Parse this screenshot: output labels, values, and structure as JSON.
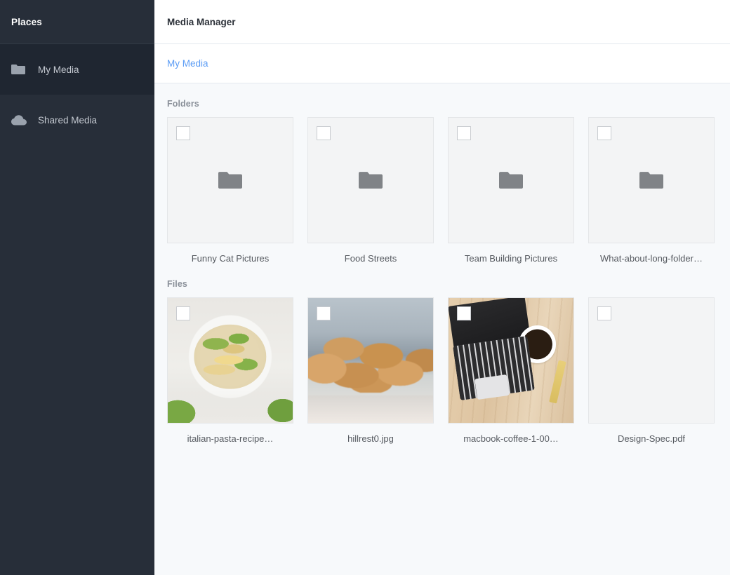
{
  "sidebar": {
    "title": "Places",
    "items": [
      {
        "label": "My Media",
        "icon": "folder-icon",
        "active": true
      },
      {
        "label": "Shared Media",
        "icon": "cloud-icon",
        "active": false
      }
    ]
  },
  "header": {
    "title": "Media Manager"
  },
  "breadcrumb": {
    "items": [
      {
        "label": "My Media"
      }
    ]
  },
  "sections": {
    "folders_label": "Folders",
    "files_label": "Files"
  },
  "folders": [
    {
      "name": "Funny Cat Pictures",
      "icon": "folder-icon",
      "checked": false
    },
    {
      "name": "Food Streets",
      "icon": "folder-icon",
      "checked": false
    },
    {
      "name": "Team Building Pictures",
      "icon": "folder-icon",
      "checked": false
    },
    {
      "name": "What-about-long-folder…",
      "icon": "folder-icon",
      "checked": false
    }
  ],
  "files": [
    {
      "name": "italian-pasta-recipe…",
      "thumb": "pasta-photo",
      "checked": false
    },
    {
      "name": "hillrest0.jpg",
      "thumb": "croissant-photo",
      "checked": false
    },
    {
      "name": "macbook-coffee-1-00…",
      "thumb": "macbook-photo",
      "checked": false
    },
    {
      "name": "Design-Spec.pdf",
      "thumb": "blank-document",
      "checked": false
    }
  ],
  "colors": {
    "sidebar_bg": "#272e39",
    "sidebar_active_bg": "#1f2631",
    "link": "#5b9cf5",
    "content_bg": "#f7f9fb",
    "tile_bg": "#f3f4f5",
    "folder_glyph": "#808387"
  }
}
